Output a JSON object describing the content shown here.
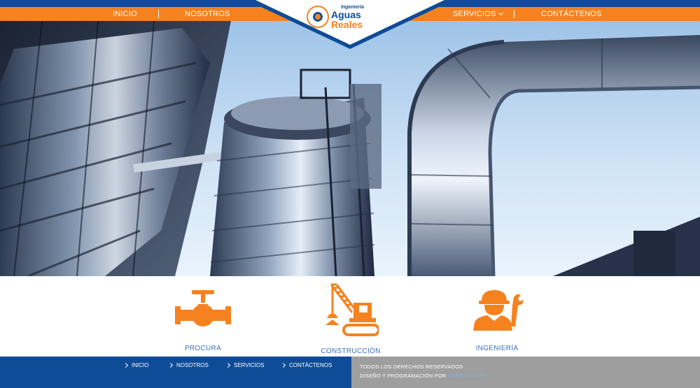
{
  "header": {
    "nav_left": [
      {
        "label": "INICIO"
      },
      {
        "label": "NOSOTROS"
      }
    ],
    "nav_right": [
      {
        "label": "SERVICIOS"
      },
      {
        "label": "CONTÁCTENOS"
      }
    ],
    "logo": {
      "small": "Ingeniería",
      "word1": "Aguas",
      "word2": "Reales"
    }
  },
  "services": [
    {
      "label": "PROCURA",
      "icon": "valve-icon"
    },
    {
      "label": "CONSTRUCCIÓN",
      "icon": "crane-icon"
    },
    {
      "label": "INGENIERÍA",
      "icon": "engineer-icon"
    }
  ],
  "footer": {
    "nav": [
      {
        "label": "INICIO"
      },
      {
        "label": "NOSOTROS"
      },
      {
        "label": "SERVICIOS"
      },
      {
        "label": "CONTÁCTENOS"
      }
    ],
    "rights": "TODOS LOS DERECHOS RESERVADOS",
    "credit_prefix": "DISEÑO Y PROGRAMACIÓN POR",
    "credit_link": "ODEF GROUP"
  },
  "colors": {
    "brand_blue": "#0f4c97",
    "brand_orange": "#f5821f",
    "footer_gray": "#9e9e9e"
  }
}
